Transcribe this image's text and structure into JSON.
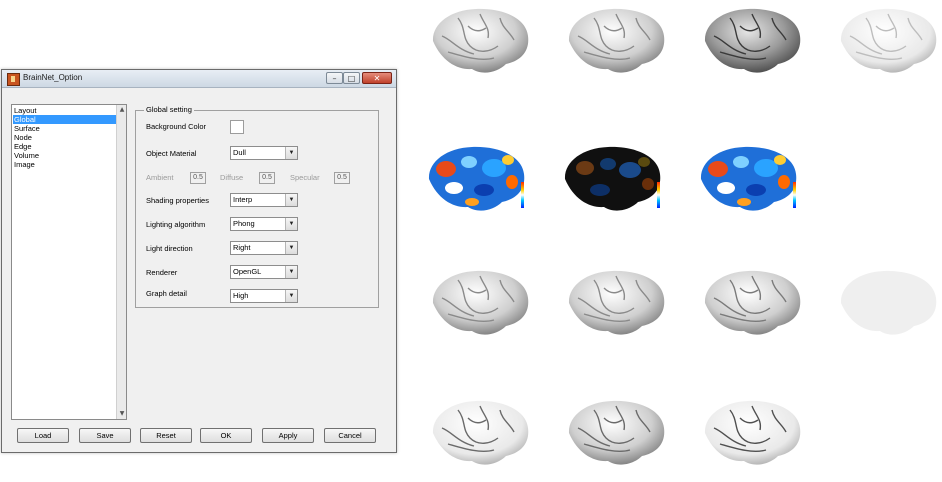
{
  "window": {
    "title": "BrainNet_Option"
  },
  "sidebar": {
    "items": [
      {
        "label": "Layout"
      },
      {
        "label": "Global"
      },
      {
        "label": "Surface"
      },
      {
        "label": "Node"
      },
      {
        "label": "Edge"
      },
      {
        "label": "Volume"
      },
      {
        "label": "Image"
      }
    ],
    "selected": "Global"
  },
  "global_setting": {
    "title": "Global setting",
    "background_color_label": "Background Color",
    "background_color": "#ffffff",
    "object_material_label": "Object Material",
    "object_material_value": "Dull",
    "ambient_label": "Ambient",
    "ambient_value": "0.5",
    "diffuse_label": "Diffuse",
    "diffuse_value": "0.5",
    "specular_label": "Specular",
    "specular_value": "0.5",
    "shading_label": "Shading properties",
    "shading_value": "Interp",
    "lighting_algorithm_label": "Lighting algorithm",
    "lighting_algorithm_value": "Phong",
    "light_direction_label": "Light direction",
    "light_direction_value": "Right",
    "renderer_label": "Renderer",
    "renderer_value": "OpenGL",
    "graph_detail_label": "Graph detail",
    "graph_detail_value": "High"
  },
  "buttons": {
    "load": "Load",
    "save": "Save",
    "reset": "Reset",
    "ok": "OK",
    "apply": "Apply",
    "cancel": "Cancel"
  },
  "icons": {
    "minimize": "minimize-icon",
    "maximize": "maximize-icon",
    "close": "close-icon",
    "dropdown": "chevron-down-icon"
  },
  "colors": {
    "selection": "#3399ff",
    "close_button": "#c0412b"
  }
}
